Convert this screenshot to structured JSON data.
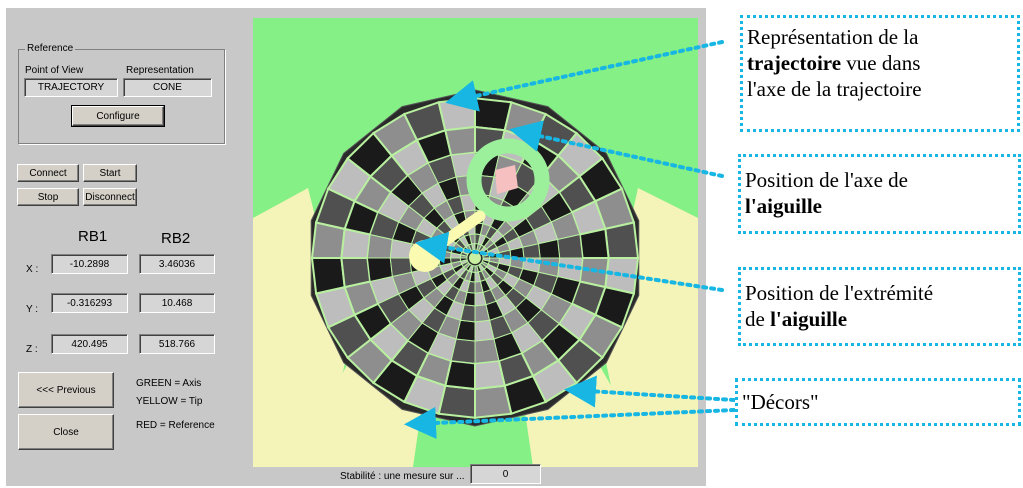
{
  "reference": {
    "group_label": "Reference",
    "point_of_view_label": "Point of View",
    "point_of_view_value": "TRAJECTORY",
    "representation_label": "Representation",
    "representation_value": "CONE",
    "configure_label": "Configure"
  },
  "controls": {
    "connect_label": "Connect",
    "start_label": "Start",
    "stop_label": "Stop",
    "disconnect_label": "Disconnect"
  },
  "coords": {
    "col1_header": "RB1",
    "col2_header": "RB2",
    "rows": [
      {
        "label": "X :",
        "rb1": "-10.2898",
        "rb2": "3.46036"
      },
      {
        "label": "Y :",
        "rb1": "-0.316293",
        "rb2": "10.468"
      },
      {
        "label": "Z :",
        "rb1": "420.495",
        "rb2": "518.766"
      }
    ]
  },
  "nav": {
    "previous_label": "<<< Previous",
    "close_label": "Close"
  },
  "legend": {
    "green": "GREEN = Axis",
    "yellow": "YELLOW = Tip",
    "red": "RED = Reference"
  },
  "stability": {
    "label": "Stabilité : une mesure sur ...",
    "value": "0"
  },
  "annotations": [
    {
      "line1": "Représentation de la",
      "line2_bold": "trajectoire",
      "line2_rest": " vue dans",
      "line3": "l'axe de la trajectoire"
    },
    {
      "line1": "Position de l'axe de",
      "line2_bold": "l'aiguille"
    },
    {
      "line1": "Position de l'extrémité",
      "line2_pre": "de ",
      "line2_bold": "l'aiguille"
    },
    {
      "line1": "\"Décors\""
    }
  ],
  "colors": {
    "window_bg": "#c8c8c8",
    "viewport_bg": "#85f085",
    "floor_yellow": "#f4f4b8",
    "axis_green": "#9cf09c",
    "tip_yellow": "#fafab0",
    "reference_pink": "#f6c0c0",
    "annotation_blue": "#17b6e3"
  }
}
